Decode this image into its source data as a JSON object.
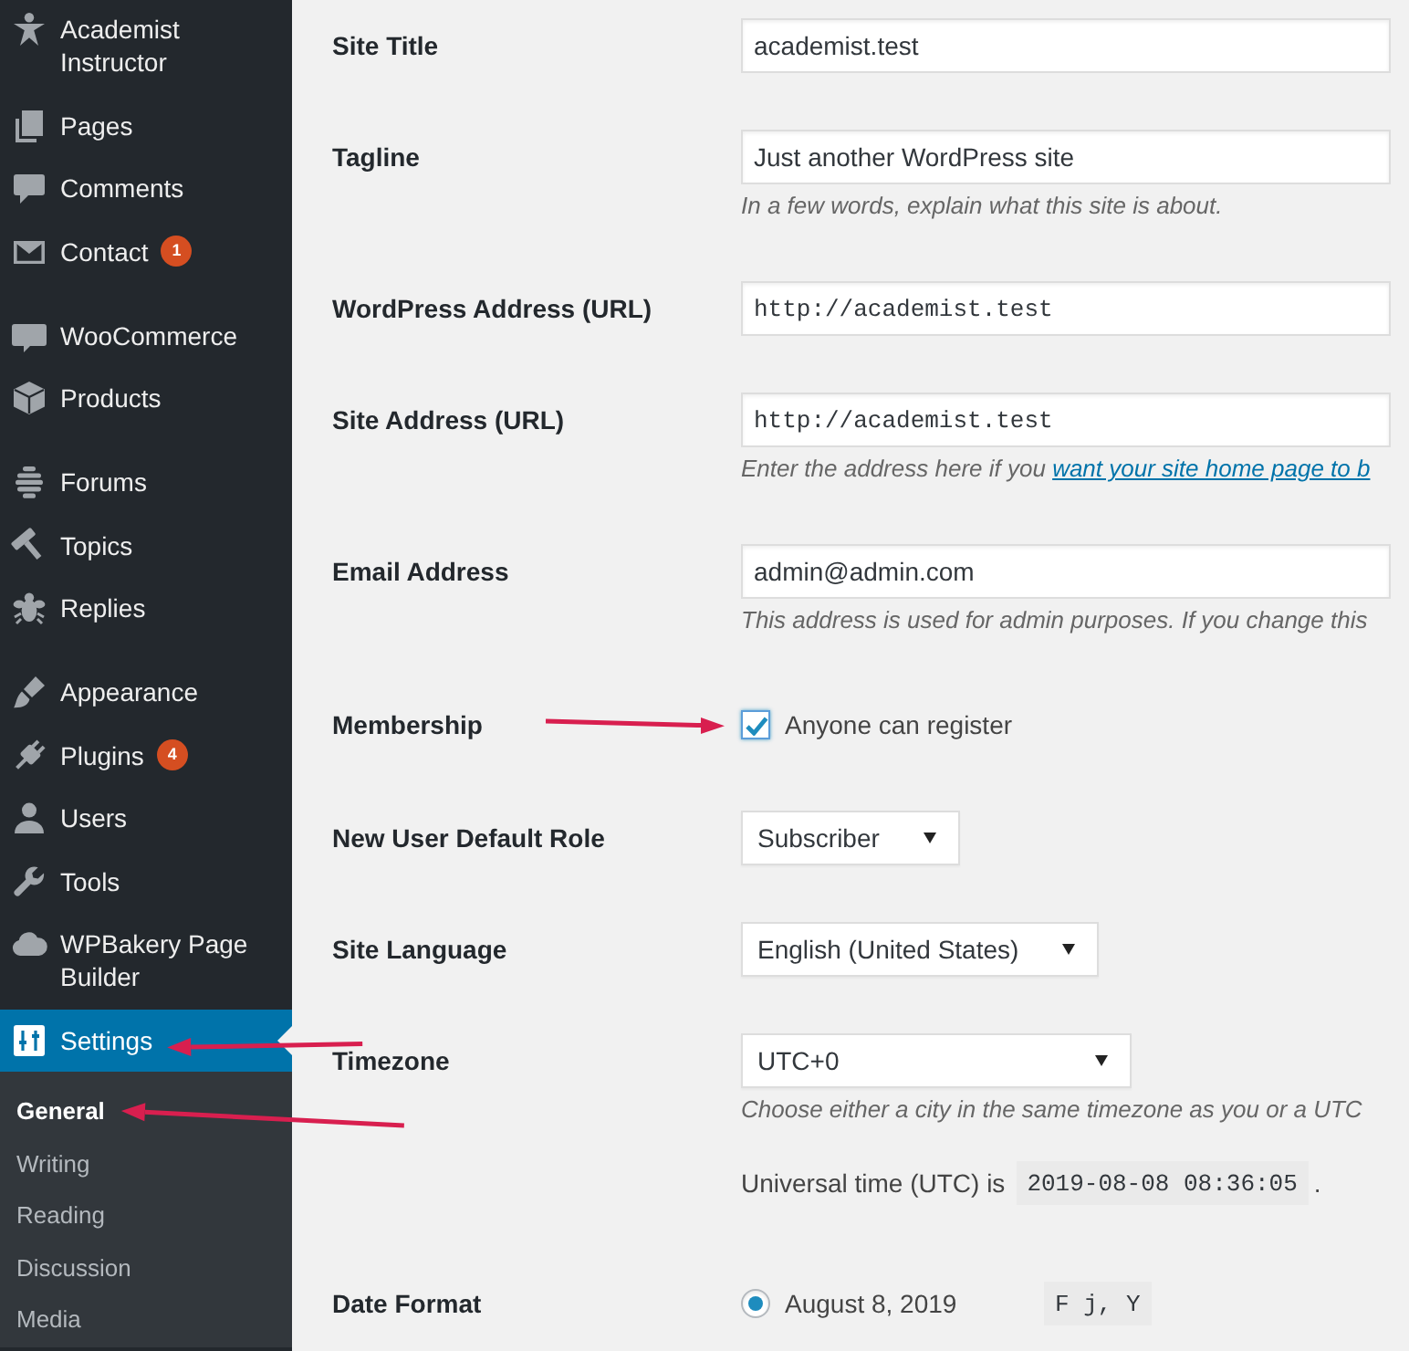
{
  "sidebar": {
    "groups": [
      {
        "items": [
          {
            "label": "Academist Instructor",
            "selected": false,
            "annotated": false
          },
          {
            "label": "Pages",
            "selected": false,
            "annotated": false
          },
          {
            "label": "Comments",
            "selected": false,
            "annotated": false
          },
          {
            "label": "Contact",
            "badge": "1",
            "selected": false,
            "annotated": false
          }
        ]
      },
      {
        "items": [
          {
            "label": "WooCommerce",
            "selected": false,
            "annotated": false
          },
          {
            "label": "Products",
            "selected": false,
            "annotated": false
          }
        ]
      },
      {
        "items": [
          {
            "label": "Forums",
            "selected": false,
            "annotated": false
          },
          {
            "label": "Topics",
            "selected": false,
            "annotated": false
          },
          {
            "label": "Replies",
            "selected": false,
            "annotated": false
          }
        ]
      },
      {
        "items": [
          {
            "label": "Appearance",
            "selected": false,
            "annotated": false
          },
          {
            "label": "Plugins",
            "badge": "4",
            "selected": false,
            "annotated": false
          },
          {
            "label": "Users",
            "selected": false,
            "annotated": false
          },
          {
            "label": "Tools",
            "selected": false,
            "annotated": false
          },
          {
            "label": "WPBakery Page Builder",
            "selected": false,
            "annotated": false
          },
          {
            "label": "Settings",
            "selected": true,
            "annotated": true,
            "submenu": [
              {
                "label": "General",
                "selected": true,
                "annotated": true
              },
              {
                "label": "Writing",
                "selected": false,
                "annotated": false
              },
              {
                "label": "Reading",
                "selected": false,
                "annotated": false
              },
              {
                "label": "Discussion",
                "selected": false,
                "annotated": false
              },
              {
                "label": "Media",
                "selected": false,
                "annotated": false
              }
            ]
          }
        ]
      }
    ]
  },
  "settings_form": {
    "rows": [
      {
        "label": "Site Title",
        "kind": "text",
        "value": "academist.test",
        "annotated": false
      },
      {
        "label": "Tagline",
        "kind": "text",
        "value": "Just another WordPress site",
        "description": "In a few words, explain what this site is about.",
        "annotated": false
      },
      {
        "label": "WordPress Address (URL)",
        "kind": "url",
        "value": "http://academist.test",
        "annotated": false
      },
      {
        "label": "Site Address (URL)",
        "kind": "url",
        "value": "http://academist.test",
        "description": "Enter the address here if you",
        "description_link": "want your site home page to b",
        "annotated": false
      },
      {
        "label": "Email Address",
        "kind": "email",
        "value": "admin@admin.com",
        "description": "This address is used for admin purposes. If you change this",
        "annotated": false
      },
      {
        "label": "Membership",
        "kind": "checkbox",
        "option": "Anyone can register",
        "checked": true,
        "annotated": true
      },
      {
        "label": "New User Default Role",
        "kind": "select",
        "value": "Subscriber",
        "annotated": false
      },
      {
        "label": "Site Language",
        "kind": "select",
        "value": "English (United States)",
        "annotated": false
      },
      {
        "label": "Timezone",
        "kind": "select",
        "value": "UTC+0",
        "description": "Choose either a city in the same timezone as you or a UTC",
        "note": {
          "text": "Universal time (UTC) is",
          "code": "2019-08-08 08:36:05",
          "end": "."
        },
        "annotated": false
      },
      {
        "label": "Date Format",
        "kind": "radio",
        "options": [
          {
            "label": "August 8, 2019",
            "code": "F j, Y",
            "selected": true
          }
        ],
        "annotated": false
      }
    ]
  }
}
